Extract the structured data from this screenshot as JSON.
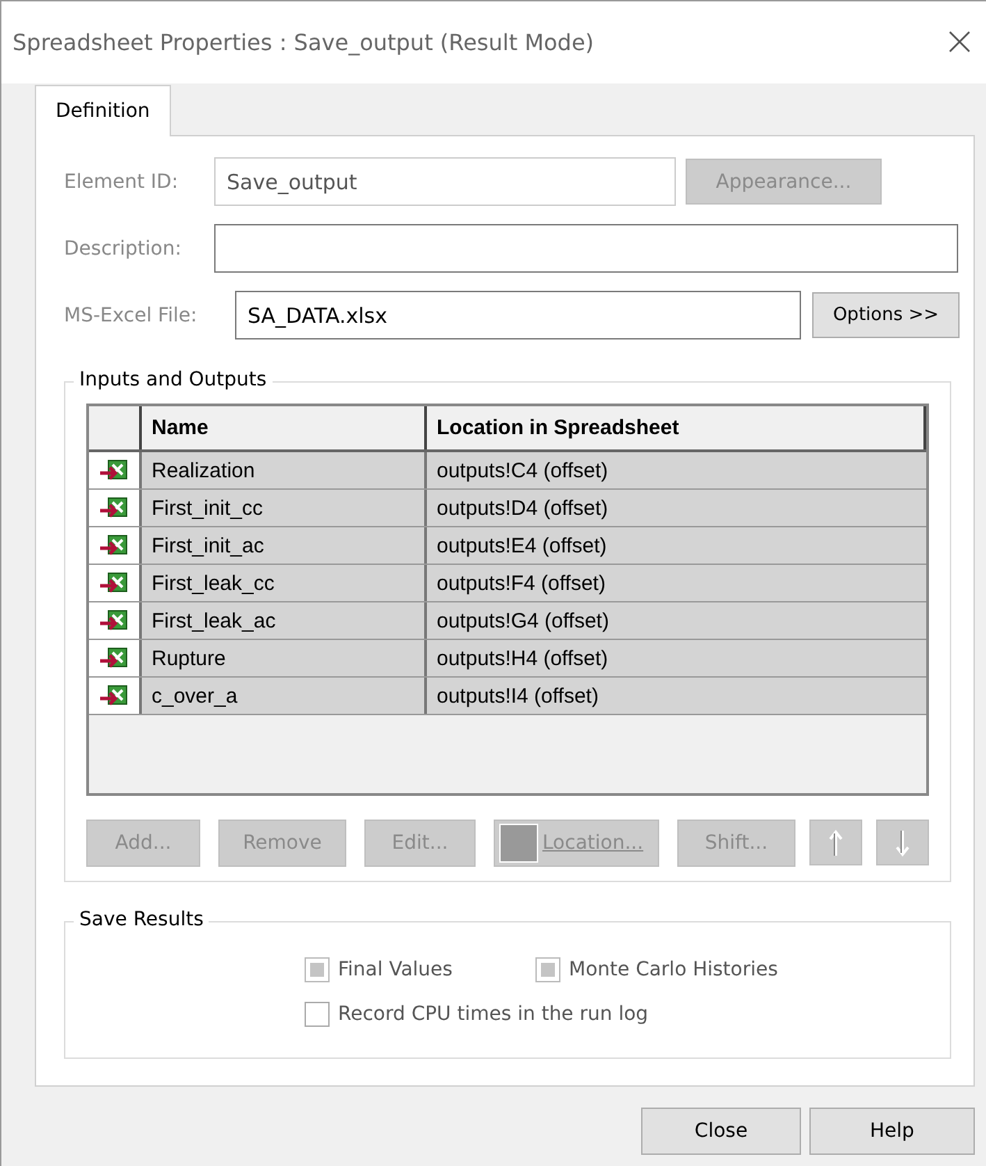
{
  "window": {
    "title": "Spreadsheet Properties : Save_output (Result Mode)"
  },
  "tabs": [
    {
      "label": "Definition",
      "selected": true
    }
  ],
  "fields": [
    {
      "label": "Element ID:",
      "value": "Save_output",
      "disabled": true,
      "button": {
        "label": "Appearance...",
        "disabled": true
      }
    },
    {
      "label": "Description:",
      "disabled": false
    },
    {
      "label": "MS-Excel File:",
      "value": "SA_DATA.xlsx",
      "disabled": false,
      "button": {
        "label": "Options >>",
        "disabled": false
      }
    }
  ],
  "inputs_outputs": {
    "title": "Inputs and Outputs",
    "columns": [
      "Name",
      "Location in Spreadsheet"
    ],
    "rows": [
      {
        "name": "Realization",
        "location": "outputs!C4 (offset)"
      },
      {
        "name": "First_init_cc",
        "location": "outputs!D4 (offset)"
      },
      {
        "name": "First_init_ac",
        "location": "outputs!E4 (offset)"
      },
      {
        "name": "First_leak_cc",
        "location": "outputs!F4 (offset)"
      },
      {
        "name": "First_leak_ac",
        "location": "outputs!G4 (offset)"
      },
      {
        "name": "Rupture",
        "location": "outputs!H4 (offset)"
      },
      {
        "name": "c_over_a",
        "location": "outputs!I4 (offset)"
      }
    ],
    "buttons": [
      {
        "kind": "text",
        "label": "Add...",
        "disabled": true
      },
      {
        "kind": "text",
        "label": "Remove",
        "disabled": true
      },
      {
        "kind": "text",
        "label": "Edit...",
        "disabled": true
      },
      {
        "kind": "swatch",
        "label": "Location...",
        "disabled": true
      },
      {
        "kind": "text",
        "label": "Shift...",
        "disabled": true
      },
      {
        "kind": "up",
        "disabled": true
      },
      {
        "kind": "down",
        "disabled": true
      }
    ]
  },
  "save_results": {
    "title": "Save Results",
    "options": [
      {
        "label": "Final Values",
        "checked": true,
        "disabled": true
      },
      {
        "label": "Monte Carlo Histories",
        "checked": true,
        "disabled": true
      },
      {
        "label": "Record CPU times in the run log",
        "checked": false,
        "disabled": false
      }
    ]
  },
  "buttons": [
    {
      "label": "Close"
    },
    {
      "label": "Help"
    }
  ]
}
